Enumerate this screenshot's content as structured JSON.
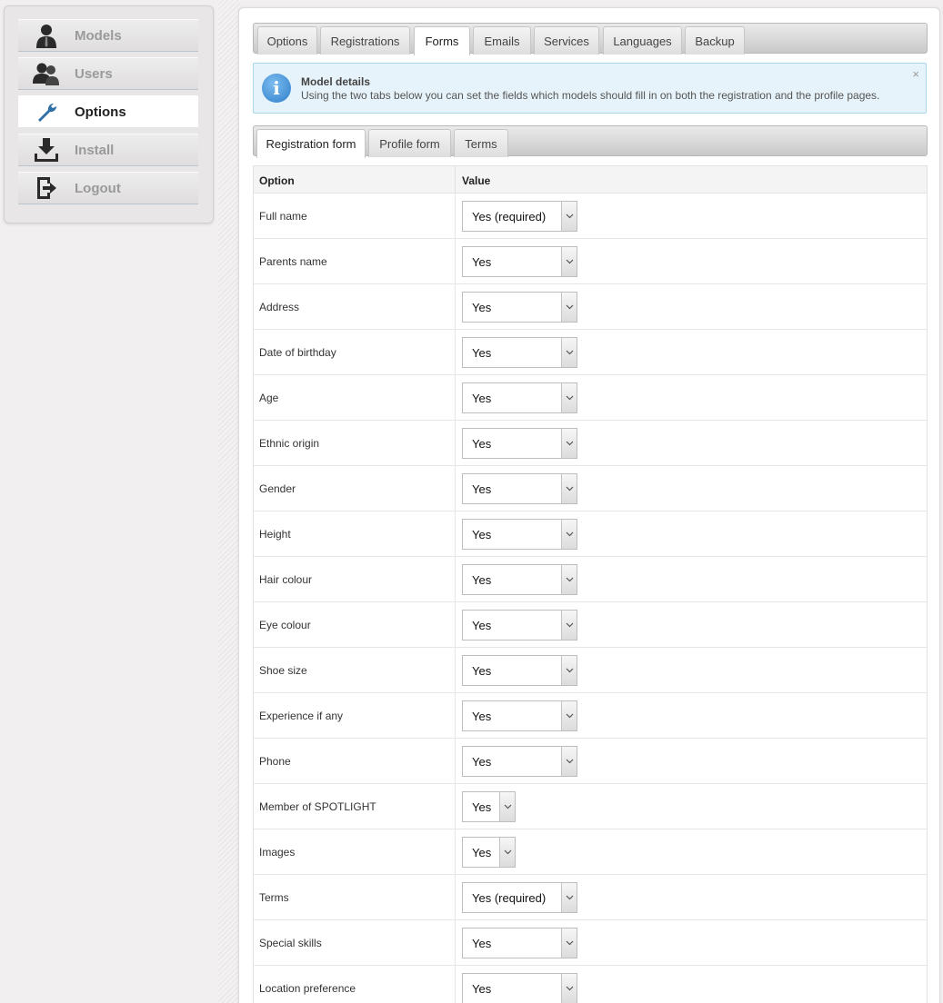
{
  "sidebar": {
    "items": [
      {
        "label": "Models",
        "icon": "person-icon",
        "active": false
      },
      {
        "label": "Users",
        "icon": "users-icon",
        "active": false
      },
      {
        "label": "Options",
        "icon": "wrench-icon",
        "active": true
      },
      {
        "label": "Install",
        "icon": "download-icon",
        "active": false
      },
      {
        "label": "Logout",
        "icon": "logout-icon",
        "active": false
      }
    ]
  },
  "top_tabs": [
    "Options",
    "Registrations",
    "Forms",
    "Emails",
    "Services",
    "Languages",
    "Backup"
  ],
  "top_tab_active": "Forms",
  "info": {
    "title": "Model details",
    "text": "Using the two tabs below you can set the fields which models should fill in on both the registration and the profile pages.",
    "close": "×"
  },
  "sub_tabs": [
    "Registration form",
    "Profile form",
    "Terms"
  ],
  "sub_tab_active": "Registration form",
  "table": {
    "headers": [
      "Option",
      "Value"
    ],
    "rows": [
      {
        "option": "Full name",
        "value": "Yes (required)"
      },
      {
        "option": "Parents name",
        "value": "Yes"
      },
      {
        "option": "Address",
        "value": "Yes"
      },
      {
        "option": "Date of birthday",
        "value": "Yes"
      },
      {
        "option": "Age",
        "value": "Yes"
      },
      {
        "option": "Ethnic origin",
        "value": "Yes"
      },
      {
        "option": "Gender",
        "value": "Yes"
      },
      {
        "option": "Height",
        "value": "Yes"
      },
      {
        "option": "Hair colour",
        "value": "Yes"
      },
      {
        "option": "Eye colour",
        "value": "Yes"
      },
      {
        "option": "Shoe size",
        "value": "Yes"
      },
      {
        "option": "Experience if any",
        "value": "Yes"
      },
      {
        "option": "Phone",
        "value": "Yes"
      },
      {
        "option": "Member of SPOTLIGHT",
        "value": "Yes"
      },
      {
        "option": "Images",
        "value": "Yes"
      },
      {
        "option": "Terms",
        "value": "Yes (required)"
      },
      {
        "option": "Special skills",
        "value": "Yes"
      },
      {
        "option": "Location preference",
        "value": "Yes"
      }
    ]
  },
  "colors": {
    "accent_blue": "#2f7ec9",
    "info_bg": "#e6f3fa"
  }
}
